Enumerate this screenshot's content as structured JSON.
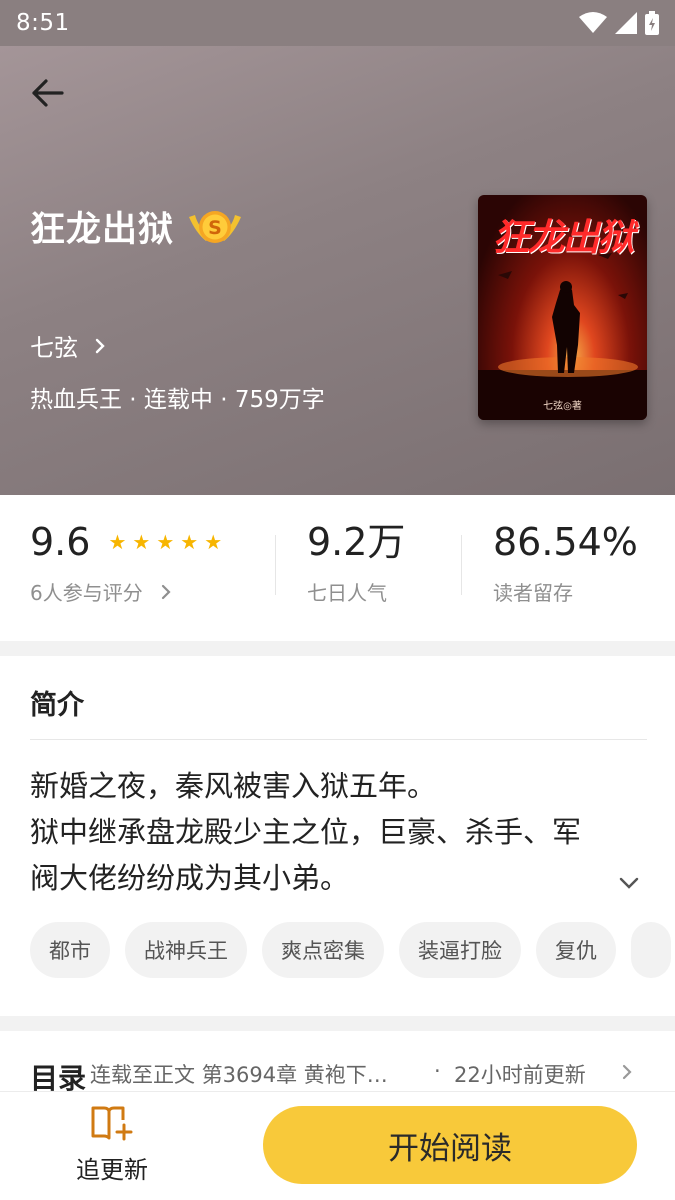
{
  "status_bar": {
    "time": "8:51"
  },
  "book": {
    "title": "狂龙出狱",
    "badge": "S",
    "author": "七弦",
    "meta": "热血兵王 · 连载中 · 759万字",
    "cover_title": "狂龙出狱",
    "cover_author": "七弦◎著"
  },
  "stats": {
    "rating": "9.6",
    "rating_stars": 5,
    "rating_label": "6人参与评分",
    "popularity": "9.2万",
    "popularity_label": "七日人气",
    "retention": "86.54%",
    "retention_label": "读者留存"
  },
  "intro": {
    "title": "简介",
    "lines": [
      "新婚之夜，秦风被害入狱五年。",
      "狱中继承盘龙殿少主之位，巨豪、杀手、军",
      "阀大佬纷纷成为其小弟。"
    ]
  },
  "tags": [
    "都市",
    "战神兵王",
    "爽点密集",
    "装逼打脸",
    "复仇"
  ],
  "catalog": {
    "title": "目录",
    "latest_chapter": "连载至正文 第3694章 黄袍下…",
    "dot": "·",
    "updated": "22小时前更新"
  },
  "bottom_bar": {
    "follow_label": "追更新",
    "start_label": "开始阅读"
  },
  "colors": {
    "accent": "#f8c93a",
    "star": "#f7b500",
    "hero_bg": "#8d8183"
  }
}
